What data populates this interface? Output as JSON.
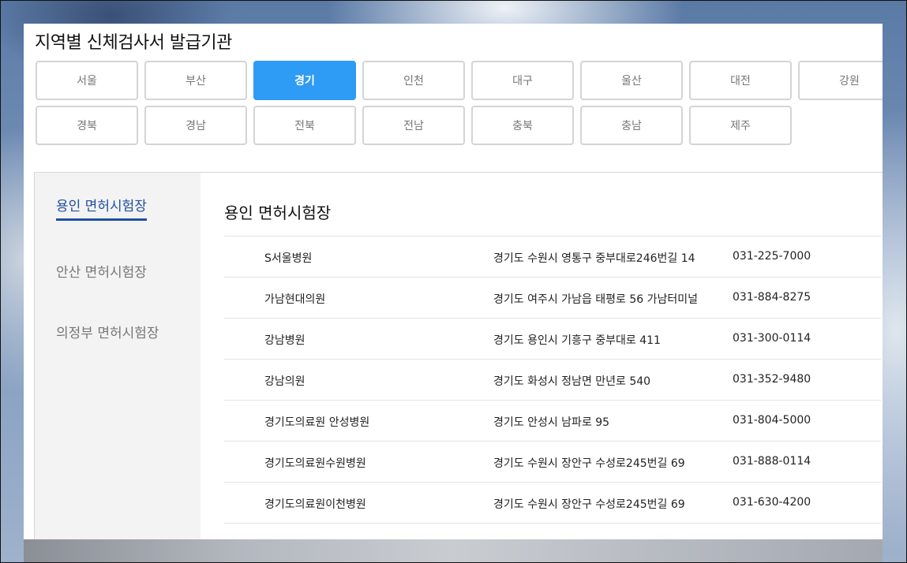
{
  "page": {
    "title": "지역별 신체검사서 발급기관"
  },
  "regions": [
    {
      "label": "서울",
      "active": false
    },
    {
      "label": "부산",
      "active": false
    },
    {
      "label": "경기",
      "active": true
    },
    {
      "label": "인천",
      "active": false
    },
    {
      "label": "대구",
      "active": false
    },
    {
      "label": "울산",
      "active": false
    },
    {
      "label": "대전",
      "active": false
    },
    {
      "label": "강원",
      "active": false
    },
    {
      "label": "경북",
      "active": false
    },
    {
      "label": "경남",
      "active": false
    },
    {
      "label": "전북",
      "active": false
    },
    {
      "label": "전남",
      "active": false
    },
    {
      "label": "충북",
      "active": false
    },
    {
      "label": "충남",
      "active": false
    },
    {
      "label": "제주",
      "active": false
    }
  ],
  "sidebar": {
    "items": [
      {
        "label": "용인 면허시험장",
        "active": true
      },
      {
        "label": "안산 면허시험장",
        "active": false
      },
      {
        "label": "의정부 면허시험장",
        "active": false
      }
    ]
  },
  "main": {
    "title": "용인 면허시험장",
    "rows": [
      {
        "name": "S서울병원",
        "address": "경기도 수원시 영통구 중부대로246번길 14",
        "phone": "031-225-7000"
      },
      {
        "name": "가남현대의원",
        "address": "경기도 여주시 가남읍 태평로 56 가남터미널",
        "phone": "031-884-8275"
      },
      {
        "name": "강남병원",
        "address": "경기도 용인시 기흥구 중부대로 411",
        "phone": "031-300-0114"
      },
      {
        "name": "강남의원",
        "address": "경기도 화성시 정남면 만년로 540",
        "phone": "031-352-9480"
      },
      {
        "name": "경기도의료원 안성병원",
        "address": "경기도 안성시 남파로 95",
        "phone": "031-804-5000"
      },
      {
        "name": "경기도의료원수원병원",
        "address": "경기도 수원시 장안구 수성로245번길 69",
        "phone": "031-888-0114"
      },
      {
        "name": "경기도의료원이천병원",
        "address": "경기도 수원시 장안구 수성로245번길 69",
        "phone": "031-630-4200"
      }
    ]
  },
  "colors": {
    "accent": "#2e9bf5",
    "sidebar_active": "#1f4fa0"
  }
}
